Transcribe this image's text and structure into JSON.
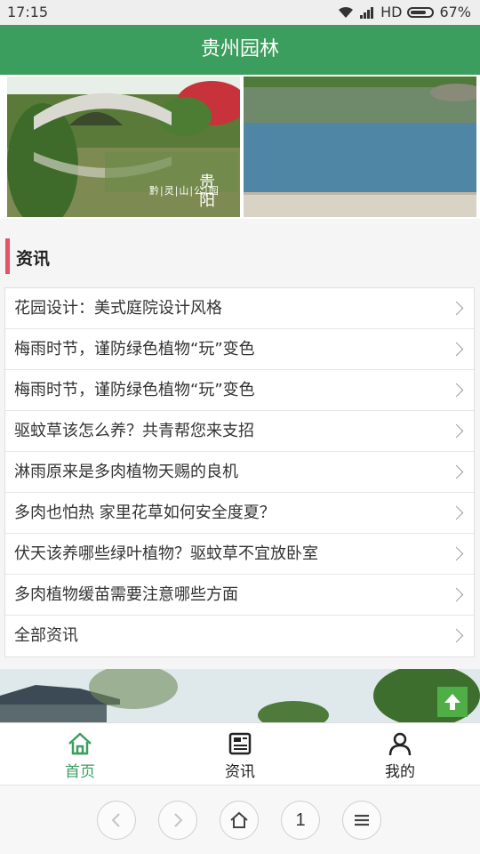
{
  "status_bar": {
    "time": "17:15",
    "network": "HD",
    "battery": "67%"
  },
  "header": {
    "title": "贵州园林"
  },
  "banner": {
    "left_caption": "黔|灵|山|公|园",
    "left_logo_top": "贵",
    "left_logo_bottom": "阳"
  },
  "news_section": {
    "title": "资讯",
    "accent_color": "#e5536a",
    "items": [
      {
        "label": "花园设计：美式庭院设计风格"
      },
      {
        "label": "梅雨时节，谨防绿色植物“玩”变色"
      },
      {
        "label": "梅雨时节，谨防绿色植物“玩”变色"
      },
      {
        "label": "驱蚊草该怎么养？共青帮您来支招"
      },
      {
        "label": "淋雨原来是多肉植物天赐的良机"
      },
      {
        "label": "多肉也怕热 家里花草如何安全度夏？"
      },
      {
        "label": "伏天该养哪些绿叶植物？驱蚊草不宜放卧室"
      },
      {
        "label": "多肉植物缓苗需要注意哪些方面"
      },
      {
        "label": "全部资讯"
      }
    ]
  },
  "tab_bar": {
    "active_color": "#3c9e5e",
    "tabs": [
      {
        "label": "首页",
        "icon": "home-icon",
        "active": true
      },
      {
        "label": "资讯",
        "icon": "news-icon",
        "active": false
      },
      {
        "label": "我的",
        "icon": "user-icon",
        "active": false
      }
    ]
  },
  "browser_nav": {
    "tab_count": "1"
  },
  "theme": {
    "primary": "#3c9e5e",
    "back_to_top": "#4fae45"
  }
}
